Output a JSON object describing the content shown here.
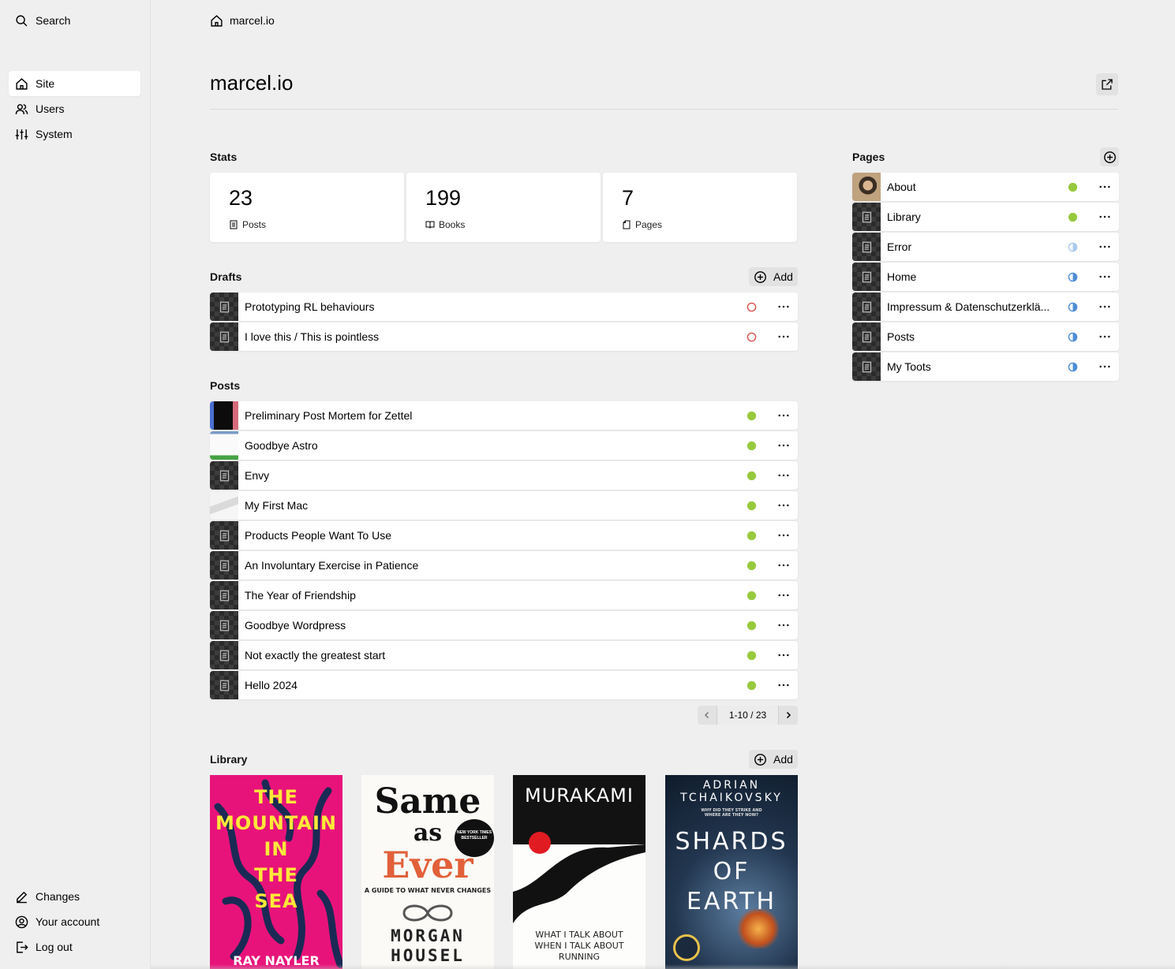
{
  "sidebar": {
    "search_label": "Search",
    "menu": [
      {
        "label": "Site",
        "active": true
      },
      {
        "label": "Users",
        "active": false
      },
      {
        "label": "System",
        "active": false
      }
    ],
    "bottom": [
      {
        "label": "Changes"
      },
      {
        "label": "Your account"
      },
      {
        "label": "Log out"
      }
    ]
  },
  "breadcrumb": {
    "label": "marcel.io"
  },
  "page": {
    "title": "marcel.io"
  },
  "stats": {
    "heading": "Stats",
    "items": [
      {
        "value": "23",
        "label": "Posts"
      },
      {
        "value": "199",
        "label": "Books"
      },
      {
        "value": "7",
        "label": "Pages"
      }
    ]
  },
  "drafts": {
    "heading": "Drafts",
    "add_label": "Add",
    "items": [
      {
        "title": "Prototyping RL behaviours",
        "status": "draft"
      },
      {
        "title": "I love this / This is pointless",
        "status": "draft"
      }
    ]
  },
  "posts": {
    "heading": "Posts",
    "items": [
      {
        "title": "Preliminary Post Mortem for Zettel",
        "status": "listed"
      },
      {
        "title": "Goodbye Astro",
        "status": "listed"
      },
      {
        "title": "Envy",
        "status": "listed"
      },
      {
        "title": "My First Mac",
        "status": "listed"
      },
      {
        "title": "Products People Want To Use",
        "status": "listed"
      },
      {
        "title": "An Involuntary Exercise in Patience",
        "status": "listed"
      },
      {
        "title": "The Year of Friendship",
        "status": "listed"
      },
      {
        "title": "Goodbye Wordpress",
        "status": "listed"
      },
      {
        "title": "Not exactly the greatest start",
        "status": "listed"
      },
      {
        "title": "Hello 2024",
        "status": "listed"
      }
    ],
    "pagination": "1-10 / 23"
  },
  "pages": {
    "heading": "Pages",
    "items": [
      {
        "title": "About",
        "status": "listed"
      },
      {
        "title": "Library",
        "status": "listed"
      },
      {
        "title": "Error",
        "status": "unlisted-light"
      },
      {
        "title": "Home",
        "status": "unlisted"
      },
      {
        "title": "Impressum & Datenschutzerklä...",
        "status": "unlisted"
      },
      {
        "title": "Posts",
        "status": "unlisted"
      },
      {
        "title": "My Toots",
        "status": "unlisted"
      }
    ]
  },
  "library": {
    "heading": "Library",
    "add_label": "Add",
    "books": [
      {
        "lines": [
          "THE",
          "MOUNTAIN",
          "IN",
          "THE",
          "SEA"
        ],
        "author": "RAY NAYLER",
        "tagline": "",
        "badge": ""
      },
      {
        "lines": [
          "Same",
          "as",
          "Ever"
        ],
        "author": "MORGAN HOUSEL",
        "tagline": "A GUIDE TO WHAT NEVER CHANGES",
        "badge": "NEW YORK TIMES BESTSELLER"
      },
      {
        "lines": [
          "MURAKAMI"
        ],
        "author": "",
        "tagline": "WHAT I TALK ABOUT WHEN I TALK ABOUT RUNNING",
        "badge": ""
      },
      {
        "lines": [
          "SHARDS",
          "OF",
          "EARTH"
        ],
        "author": "ADRIAN TCHAIKOVSKY",
        "tagline": "WHY DID THEY STRIKE AND WHERE ARE THEY NOW?",
        "badge": ""
      }
    ]
  },
  "colors": {
    "listed": "#97c93d",
    "draft": "#d9534f",
    "unlisted": "#4d8dd6"
  }
}
